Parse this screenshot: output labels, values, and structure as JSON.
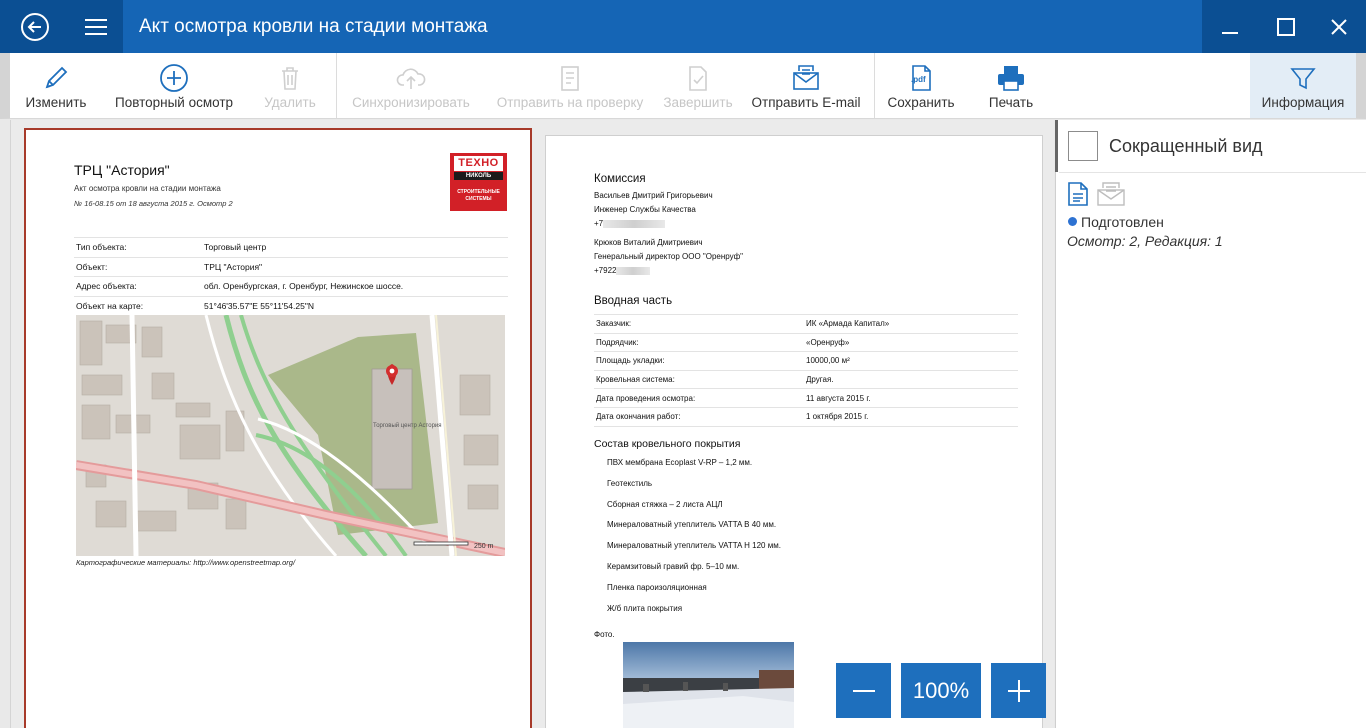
{
  "window": {
    "title": "Акт осмотра кровли на стадии монтажа"
  },
  "toolbar": {
    "edit": "Изменить",
    "reinspect": "Повторный осмотр",
    "delete": "Удалить",
    "sync": "Синхронизировать",
    "send_review": "Отправить на проверку",
    "finish": "Завершить",
    "send_email": "Отправить E-mail",
    "save": "Сохранить",
    "print": "Печать",
    "info": "Информация",
    "pdf_badge": ".pdf"
  },
  "page1": {
    "title": "ТРЦ \"Астория\"",
    "subtitle": "Акт осмотра кровли на стадии монтажа",
    "number": "№ 16-08.15 от 18 августа 2015 г. Осмотр 2",
    "logo": {
      "line1": "ТЕХНО",
      "line2": "НИКОЛЬ",
      "line3": "СТРОИТЕЛЬНЫЕ СИСТЕМЫ"
    },
    "rows": [
      {
        "k": "Тип объекта:",
        "v": "Торговый центр"
      },
      {
        "k": "Объект:",
        "v": "ТРЦ \"Астория\""
      },
      {
        "k": "Адрес объекта:",
        "v": "обл. Оренбургская, г. Оренбург, Нежинское шоссе."
      },
      {
        "k": "Объект на карте:",
        "v": "51°46'35.57\"E 55°11'54.25\"N"
      }
    ],
    "map_label": "Торговый центр Астория",
    "map_scale": "250 m",
    "map_caption": "Картографические материалы: http://www.openstreetmap.org/"
  },
  "page2": {
    "commission_title": "Комиссия",
    "person1": {
      "name": "Васильев Дмитрий Григорьевич",
      "role": "Инженер Службы Качества",
      "phone": "+7"
    },
    "person2": {
      "name": "Крюков Виталий Дмитриевич",
      "role": "Генеральный директор ООО \"Оренруф\"",
      "phone": "+7922"
    },
    "intro_title": "Вводная часть",
    "intro_rows": [
      {
        "k": "Заказчик:",
        "v": "ИК «Армада Капитал»"
      },
      {
        "k": "Подрядчик:",
        "v": "«Оренруф»"
      },
      {
        "k": "Площадь укладки:",
        "v": "10000,00 м²"
      },
      {
        "k": "Кровельная система:",
        "v": "Другая."
      },
      {
        "k": "Дата проведения осмотра:",
        "v": "11 августа 2015 г."
      },
      {
        "k": "Дата окончания работ:",
        "v": "1 октября 2015 г."
      }
    ],
    "layers_title": "Состав кровельного покрытия",
    "layers": [
      "ПВХ мембрана Ecoplast V-RP – 1,2 мм.",
      "Геотекстиль",
      "Сборная стяжка – 2 листа АЦЛ",
      "Минераловатный утеплитель VATTA В 40 мм.",
      "Минераловатный утеплитель VATTA Н 120 мм.",
      "Керамзитовый гравий фр. 5–10 мм.",
      "Пленка пароизоляционная",
      "Ж/б плита покрытия"
    ],
    "photo_label": "Фото."
  },
  "zoom": {
    "value": "100%"
  },
  "side": {
    "compact_label": "Сокращенный вид",
    "status": "Подготовлен",
    "inspection": "Осмотр: 2, Редакция: 1"
  },
  "colors": {
    "titlebar": "#1565b5",
    "titlebar_dark": "#0b4f93",
    "accent": "#1e6fbd",
    "page_border": "#a73a2a",
    "status_dot": "#2d72d2"
  }
}
